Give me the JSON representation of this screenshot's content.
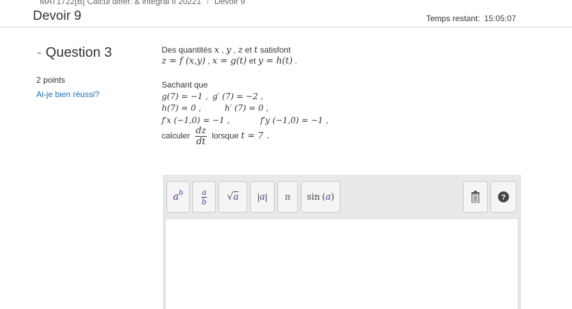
{
  "breadcrumb": {
    "course": "MAT1722[B] Calcul différ. & intégral II 20221",
    "separator": "/",
    "current": "Devoir 9"
  },
  "header": {
    "title": "Devoir 9",
    "timer_label": "Temps restant:",
    "timer_value": "15:05:07"
  },
  "question": {
    "title": "Question 3",
    "points": "2 points",
    "self_check_link": "Ai-je bien réussi?",
    "intro": "Des quantités",
    "intro_suffix": "satisfont",
    "vars": {
      "x": "x",
      "y": "y",
      "z": "z",
      "t": "t"
    },
    "given_label": "Sachant que",
    "calc_label": "calculer",
    "when_label": "lorsque",
    "et": "et",
    "relations": {
      "z": "z = f (x,y)",
      "x": "x = g(t)",
      "y": "y = h(t)"
    },
    "conditions": {
      "g7": "g(7) = −1 ,",
      "gp7": "g′ (7) = −2 ,",
      "h7": "h(7) = 0 ,",
      "hp7": "h′ (7) = 0 ,",
      "fx": "f′x (−1,0) = −1 ,",
      "fy": "f′y (−1,0) = −1 ,"
    },
    "derivative": {
      "num": "dz",
      "den": "dt"
    },
    "when_value": "t = 7 ."
  },
  "toolbar": {
    "power_base": "a",
    "power_exp": "b",
    "frac_num": "a",
    "frac_den": "b",
    "sqrt_arg": "a",
    "abs_arg": "a",
    "pi": "π",
    "sin_fn": "sin",
    "sin_arg": "a"
  },
  "colors": {
    "link": "#1a6fb5",
    "toolbar_purple": "#5b2a86",
    "toolbar_blue": "#2b3fb0"
  }
}
